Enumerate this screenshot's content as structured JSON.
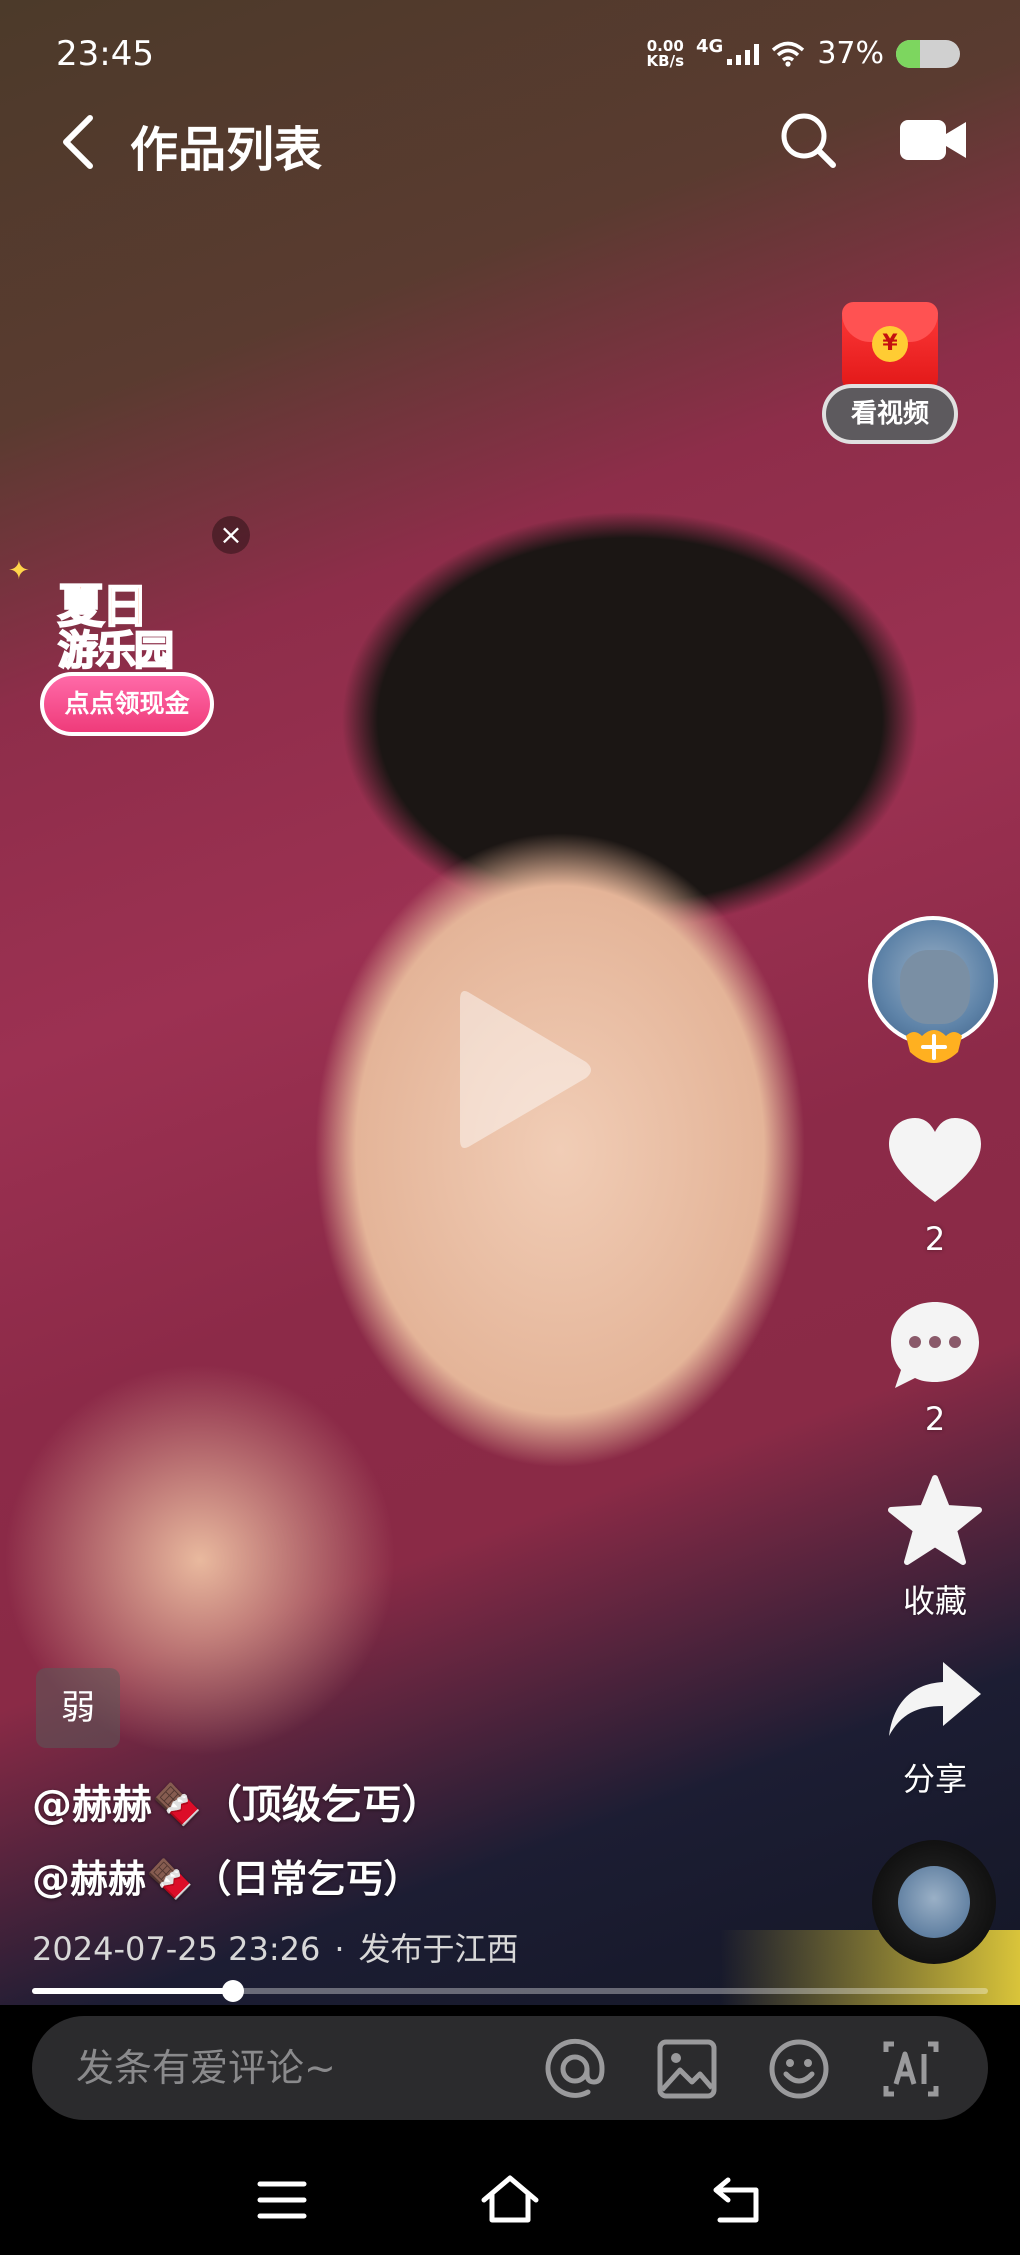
{
  "status_bar": {
    "time": "23:45",
    "net_speed_value": "0.00",
    "net_speed_unit": "KB/s",
    "network": "4G",
    "battery_text": "37%",
    "battery_level": 0.37
  },
  "nav": {
    "title": "作品列表",
    "back_icon": "chevron-left-icon",
    "search_icon": "search-icon",
    "camera_icon": "video-camera-icon"
  },
  "promo": {
    "red_packet_coin": "¥",
    "watch_video_label": "看视频",
    "close_label": "×",
    "summer_line1": "夏日",
    "summer_line2": "游乐园",
    "cash_label": "点点领现金"
  },
  "actions": {
    "like_count": "2",
    "comment_count": "2",
    "favorite_label": "收藏",
    "share_label": "分享"
  },
  "post": {
    "badge": "弱",
    "mention1": "@赫赫🍫（顶级乞丐）",
    "mention2": "@赫赫🍫（日常乞丐）",
    "date": "2024-07-25 23:26",
    "separator": "·",
    "location": "发布于江西"
  },
  "progress": {
    "fraction": 0.21
  },
  "comment_bar": {
    "placeholder": "发条有爱评论~",
    "icons": [
      "at-icon",
      "image-icon",
      "emoji-icon",
      "ai-icon"
    ]
  },
  "system_nav": {
    "icons": [
      "menu-icon",
      "home-icon",
      "back-icon"
    ]
  },
  "colors": {
    "like": "#ffffff",
    "progress_fill": "#ffffff",
    "battery": "#7dd65f",
    "cash_button": "#ef3b7a",
    "red_packet": "#e01616"
  }
}
